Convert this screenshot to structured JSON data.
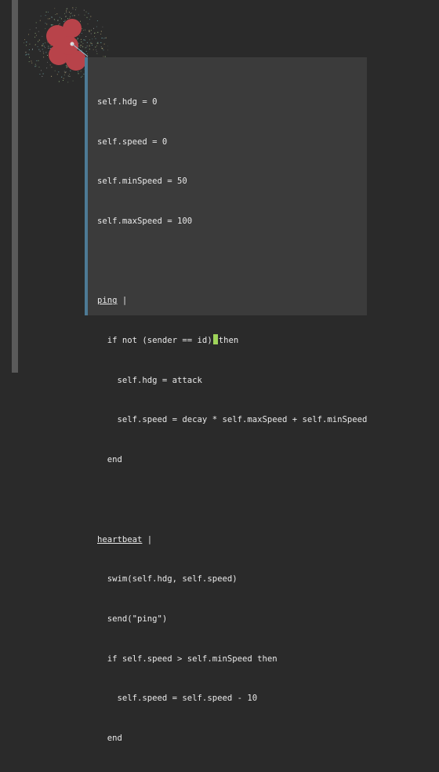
{
  "colors": {
    "background": "#2a2a2a",
    "rail": "#5a5a5a",
    "panel": "#3b3b3b",
    "panel_accent": "#4d7a95",
    "code_text": "#e9e9e9",
    "cursor": "#9fd45a",
    "swarm_body": "#b8434a",
    "swarm_particles": [
      "#7ec6c9",
      "#c9b57e",
      "#9a9a9a",
      "#a4c98a"
    ]
  },
  "editor": {
    "lines": [
      "self.hdg = 0",
      "self.speed = 0",
      "self.minSpeed = 50",
      "self.maxSpeed = 100",
      "",
      "ping |",
      "  if not (sender == id) then",
      "    self.hdg = attack",
      "    self.speed = decay * self.maxSpeed + self.minSpeed",
      "  end",
      "",
      "heartbeat |",
      "  swim(self.hdg, self.speed)",
      "  send(\"ping\")",
      "  if self.speed > self.minSpeed then",
      "    self.speed = self.speed - 10",
      "  end"
    ],
    "ping_handler": {
      "name": "ping",
      "suffix": " |"
    },
    "ping_condition": {
      "before_cursor": "  if not (sender == id)",
      "after_cursor": "then"
    },
    "heartbeat_handler": {
      "name": "heartbeat",
      "suffix": " |"
    }
  },
  "scene": {
    "agent": "swarm-creature",
    "icon": "red-blob-creature"
  }
}
